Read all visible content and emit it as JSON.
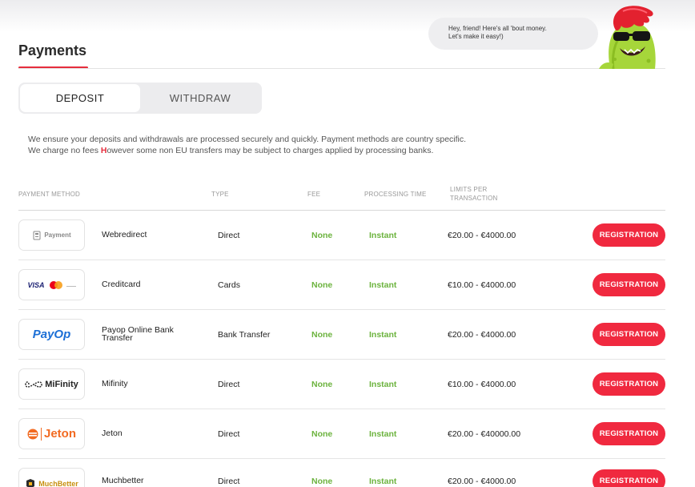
{
  "page": {
    "title": "Payments"
  },
  "mascot": {
    "speech_line1": "Hey, friend! Here's all 'bout money.",
    "speech_line2": "Let's make it easy!)"
  },
  "tabs": [
    {
      "label": "DEPOSIT",
      "active": true
    },
    {
      "label": "WITHDRAW",
      "active": false
    }
  ],
  "notice": {
    "line1": "We ensure your deposits and withdrawals are processed securely and quickly. Payment methods are country specific.",
    "line2_prefix": "We charge no fees ",
    "line2_highlight": "H",
    "line2_suffix": "owever some non EU transfers may be subject to charges applied by processing banks."
  },
  "table": {
    "headers": {
      "method": "PAYMENT METHOD",
      "type": "TYPE",
      "fee": "FEE",
      "time": "PROCESSING TIME",
      "limits_line1": "LIMITS PER",
      "limits_line2": "TRANSACTION"
    },
    "button_label": "REGISTRATION",
    "rows": [
      {
        "logo": "Payment",
        "name": "Webredirect",
        "type": "Direct",
        "fee": "None",
        "time": "Instant",
        "limits": "€20.00 - €4000.00"
      },
      {
        "logo": "VISA",
        "name": "Creditcard",
        "type": "Cards",
        "fee": "None",
        "time": "Instant",
        "limits": "€10.00 - €4000.00"
      },
      {
        "logo": "PayOp",
        "name": "Payop Online Bank Transfer",
        "type": "Bank Transfer",
        "fee": "None",
        "time": "Instant",
        "limits": "€20.00 - €4000.00"
      },
      {
        "logo": "MiFinity",
        "name": "Mifinity",
        "type": "Direct",
        "fee": "None",
        "time": "Instant",
        "limits": "€10.00 - €4000.00"
      },
      {
        "logo": "Jeton",
        "name": "Jeton",
        "type": "Direct",
        "fee": "None",
        "time": "Instant",
        "limits": "€20.00 - €40000.00"
      },
      {
        "logo": "MuchBetter",
        "name": "Muchbetter",
        "type": "Direct",
        "fee": "None",
        "time": "Instant",
        "limits": "€20.00 - €4000.00"
      }
    ]
  },
  "colors": {
    "accent": "#f0293f",
    "positive": "#6cb33e"
  }
}
